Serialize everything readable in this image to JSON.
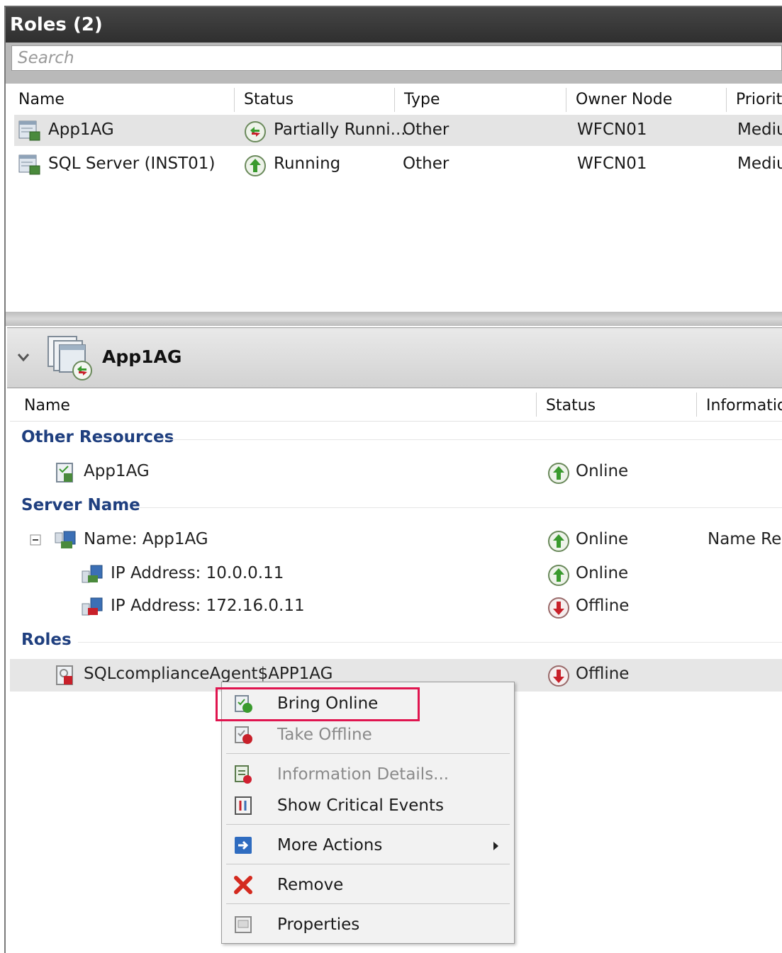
{
  "panel_title": "Roles (2)",
  "search": {
    "placeholder": "Search"
  },
  "roles_table": {
    "columns": [
      "Name",
      "Status",
      "Type",
      "Owner Node",
      "Priority"
    ],
    "rows": [
      {
        "name": "App1AG",
        "status": "Partially Runni...",
        "type": "Other",
        "owner": "WFCN01",
        "priority": "Mediu"
      },
      {
        "name": "SQL Server (INST01)",
        "status": "Running",
        "type": "Other",
        "owner": "WFCN01",
        "priority": "Mediu"
      }
    ]
  },
  "detail": {
    "title": "App1AG",
    "columns": [
      "Name",
      "Status",
      "Information"
    ],
    "sections": {
      "other_resources": "Other Resources",
      "server_name": "Server Name",
      "roles": "Roles"
    },
    "items": [
      {
        "name": "App1AG",
        "status": "Online",
        "info": ""
      },
      {
        "name": "Name: App1AG",
        "status": "Online",
        "info": "Name Res"
      },
      {
        "name": "IP Address: 10.0.0.11",
        "status": "Online",
        "info": ""
      },
      {
        "name": "IP Address: 172.16.0.11",
        "status": "Offline",
        "info": ""
      },
      {
        "name": "SQLcomplianceAgent$APP1AG",
        "status": "Offline",
        "info": ""
      }
    ]
  },
  "context_menu": {
    "items": [
      {
        "label": "Bring Online",
        "enabled": true
      },
      {
        "label": "Take Offline",
        "enabled": false
      },
      {
        "label": "Information Details...",
        "enabled": false
      },
      {
        "label": "Show Critical Events",
        "enabled": true
      },
      {
        "label": "More Actions",
        "enabled": true
      },
      {
        "label": "Remove",
        "enabled": true
      },
      {
        "label": "Properties",
        "enabled": true
      }
    ]
  },
  "colors": {
    "title_bar": "#3a3a3a",
    "section_heading": "#1f3f7f",
    "highlight_box": "#e0154f",
    "online_green": "#3a9a2e",
    "offline_red": "#c8202a"
  }
}
